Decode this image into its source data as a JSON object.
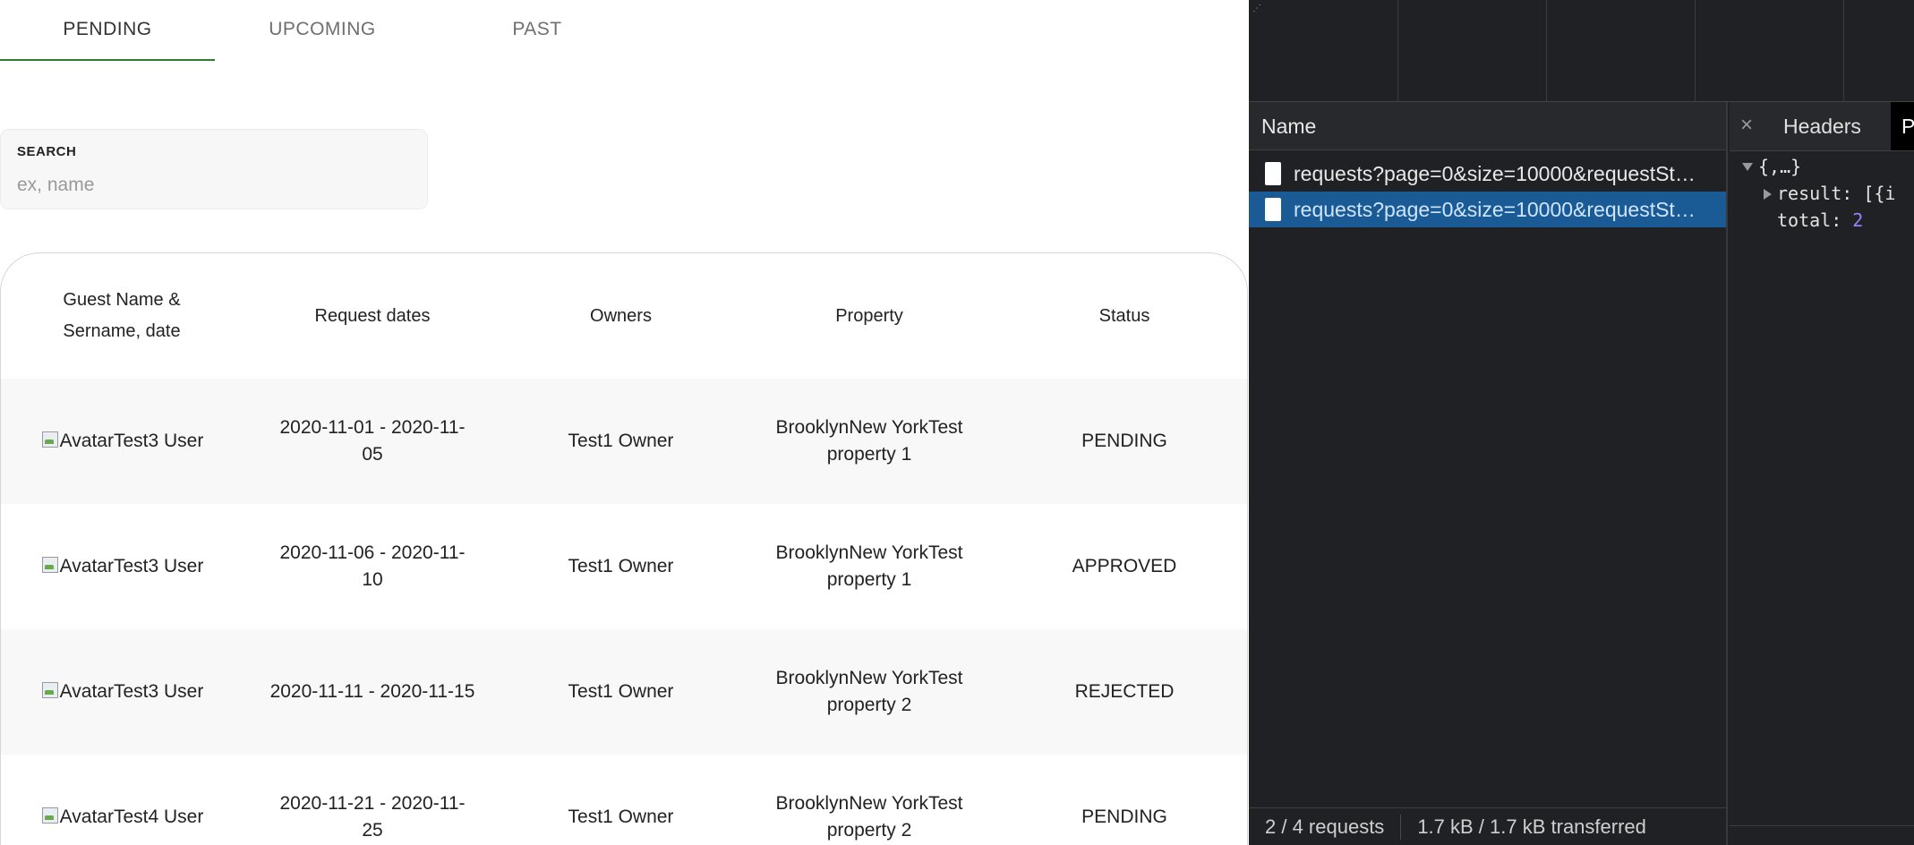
{
  "tabs": [
    "PENDING",
    "UPCOMING",
    "PAST"
  ],
  "search": {
    "label": "SEARCH",
    "placeholder": "ex, name",
    "value": ""
  },
  "table": {
    "columns": [
      "Guest Name & Sername, date",
      "Request dates",
      "Owners",
      "Property",
      "Status"
    ],
    "rows": [
      {
        "guest_img_alt": "Avatar",
        "guest": "Test3 User",
        "dates": "2020-11-01 - 2020-11-05",
        "owner": "Test1 Owner",
        "property": "BrooklynNew YorkTest property 1",
        "status": "PENDING"
      },
      {
        "guest_img_alt": "Avatar",
        "guest": "Test3 User",
        "dates": "2020-11-06 - 2020-11-10",
        "owner": "Test1 Owner",
        "property": "BrooklynNew YorkTest property 1",
        "status": "APPROVED"
      },
      {
        "guest_img_alt": "Avatar",
        "guest": "Test3 User",
        "dates": "2020-11-11 - 2020-11-15",
        "owner": "Test1 Owner",
        "property": "BrooklynNew YorkTest property 2",
        "status": "REJECTED"
      },
      {
        "guest_img_alt": "Avatar",
        "guest": "Test4 User",
        "dates": "2020-11-21 - 2020-11-25",
        "owner": "Test1 Owner",
        "property": "BrooklynNew YorkTest property 2",
        "status": "PENDING"
      }
    ]
  },
  "devtools": {
    "name_header": "Name",
    "requests": [
      "requests?page=0&size=10000&requestSt…",
      "requests?page=0&size=10000&requestSt…"
    ],
    "selected_request_index": 1,
    "status_requests": "2 / 4 requests",
    "status_transfer": "1.7 kB / 1.7 kB transferred",
    "detail_tabs": {
      "close": "×",
      "headers": "Headers",
      "preview": "P"
    },
    "json": {
      "root": "{,…}",
      "result_key": "result:",
      "result_value": "[{i",
      "total_key": "total:",
      "total_value": "2"
    }
  }
}
